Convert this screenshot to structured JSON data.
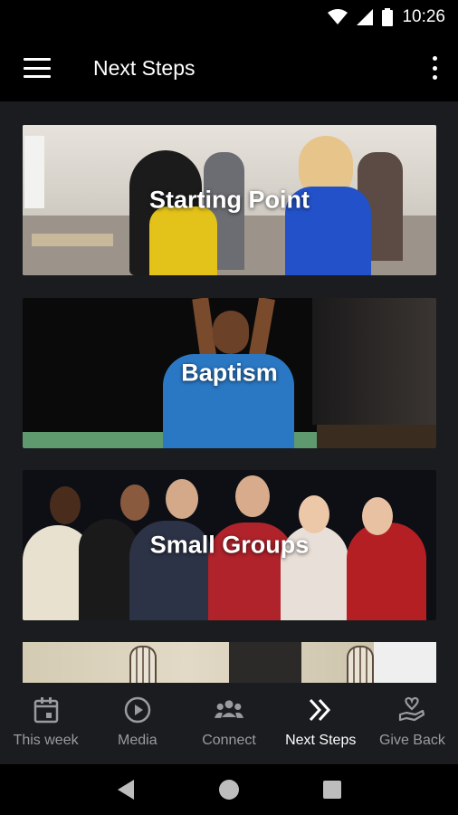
{
  "status_bar": {
    "time": "10:26"
  },
  "app_bar": {
    "title": "Next Steps"
  },
  "cards": [
    {
      "title": "Starting Point"
    },
    {
      "title": "Baptism"
    },
    {
      "title": "Small Groups"
    }
  ],
  "bottom_nav": {
    "items": [
      {
        "label": "This week",
        "icon": "calendar-icon"
      },
      {
        "label": "Media",
        "icon": "play-circle-icon"
      },
      {
        "label": "Connect",
        "icon": "people-icon"
      },
      {
        "label": "Next Steps",
        "icon": "double-chevron-icon",
        "active": true
      },
      {
        "label": "Give Back",
        "icon": "hand-heart-icon"
      }
    ]
  },
  "colors": {
    "background": "#1a1c1f",
    "app_bar": "#000000",
    "active_label": "#ffffff",
    "inactive_label": "#9a9b9d"
  }
}
